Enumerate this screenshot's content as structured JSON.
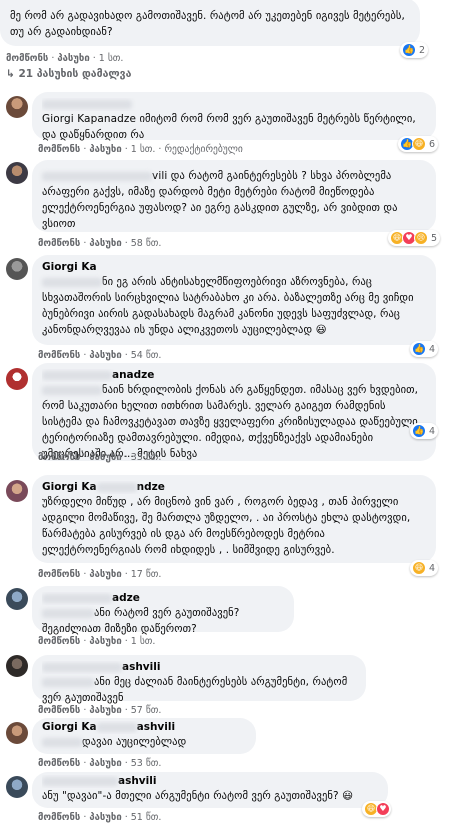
{
  "comments": [
    {
      "name": "",
      "text": "მე რომ არ გადავიხადო გამოთიშავენ. რატომ არ უკეთებენ იგივეს მეტერებს, თუ არ გადაიხდიან?",
      "actions": {
        "like": "მომწონს",
        "reply": "პასუხი",
        "time": "1 სთ."
      },
      "reactions": {
        "count": "2",
        "icons": [
          "like-icon"
        ]
      }
    },
    {
      "name": "",
      "text": "Giorgi Kapanadze იმიტომ რომ რომ ვერ გაუთიშავენ მეტრებს წერტილი, და დაწყნარდით რა",
      "actions": {
        "like": "მომწონს",
        "reply": "პასუხი",
        "time": "1 სთ.",
        "edited": "რედაქტირებული"
      },
      "reactions": {
        "count": "6",
        "icons": [
          "like-icon",
          "haha-icon"
        ]
      }
    },
    {
      "name": "",
      "text_suffix": "vili და რატომ გაინტერესებს ? სხვა პრობლემა არაფერი გაქვს, იმაზე დარდობ მეტი მეტრები რატომ მიეწოდება ელექტროენერგია უფასოდ? აი ეგრე გასკდით გულზე, არ ვიბდით და ვსიოთ",
      "actions": {
        "like": "მომწონს",
        "reply": "პასუხი",
        "time": "58 წთ."
      },
      "reactions": {
        "count": "5",
        "icons": [
          "haha-icon",
          "love-icon",
          "sad-icon"
        ]
      }
    },
    {
      "name": "Giorgi Ka",
      "text_suffix": "ნი ეგ არის ანტისახელმწიფოებრივი აზროვნება, რაც სხვათაშორის სირცხვილია სატრაბახო კი არა. ბაზალეთზე არც მე ვიჩდი ბუნებრივი აირის გადასახადს მაგრამ კანონი უდევს საფუძვლად, რაც კანონდარღვევაა ის უნდა ალიკვეთოს აუცილებლად",
      "emoji": "😃",
      "actions": {
        "like": "მომწონს",
        "reply": "პასუხი",
        "time": "54 წთ."
      },
      "reactions": {
        "count": "4",
        "icons": [
          "like-icon"
        ]
      }
    },
    {
      "name_suffix": "anadze",
      "text_suffix": "ნაინ ხრდილობის ქონას არ გაწყენდეთ. იმასაც ვერ ხვდებით, რომ საკუთარი ხელით ითხრით სამარეს. ველარ გაიგეთ რამდენის სისტემა და ჩამოვკეტავათ თავზე ყველაფერი კრიზისულადაა დაწეებული ტერიტორიაზე დამთავრებული. იმედია, თქვენზეაქვს ადამიანები უმეცრესიაში არ... მეტის ნახვა",
      "actions": {
        "like": "მომწონს",
        "reply": "პასუხი",
        "time": "33 წთ."
      },
      "reactions": {
        "count": "4",
        "icons": [
          "like-icon"
        ]
      }
    },
    {
      "name": "Giorgi Ka",
      "name_mid": "ndze",
      "text": "უზრდელი მიწუდ , არ მიცნობ ვინ ვარ , როგორ ბედავ , თან პირველი ადგილი მომაწივე, შე მართლა უზდელო, . აი პროსტა ეხლა დასტოვდი, წარმატება გისურვებ ის დგა არ მოესწრებოდეს მეტრია ელექტროენერგიას რომ იხდიდეს , . სიმშვიდე გისურვებ.",
      "actions": {
        "like": "მომწონს",
        "reply": "პასუხი",
        "time": "17 წთ."
      },
      "reactions": {
        "count": "4",
        "icons": [
          "haha-icon"
        ]
      }
    },
    {
      "name_suffix": "adze",
      "text_suffix": "ანი რატომ ვერ გაუთიშავენ? შეგიძლიათ მიზეზი დაწეროთ?",
      "actions": {
        "like": "მომწონს",
        "reply": "პასუხი",
        "time": "1 სთ."
      }
    },
    {
      "name_suffix": "ashvili",
      "text_suffix": "ანი მეც ძალიან მაინტერესებს არგუმენტი, რატომ ვერ გაუთიშავენ",
      "actions": {
        "like": "მომწონს",
        "reply": "პასუხი",
        "time": "57 წთ."
      }
    },
    {
      "name": "Giorgi Ka",
      "name_mid": "ashvili",
      "text": "დავაი აუცილებლად",
      "actions": {
        "like": "მომწონს",
        "reply": "პასუხი",
        "time": "53 წთ."
      }
    },
    {
      "name_suffix": "ashvili",
      "text": "ანუ \"დავაი\"-ა მთელი არგუმენტი რატომ ვერ გაუთიშავენ?",
      "emoji": "😃",
      "actions": {
        "like": "მომწონს",
        "reply": "პასუხი",
        "time": "51 წთ."
      },
      "reactions": {
        "count": "",
        "icons": [
          "haha-icon",
          "love-icon"
        ]
      }
    }
  ],
  "hidden_replies": "21 პასუხის დამალვა",
  "colors": {
    "bubble": "#f0f2f5",
    "like": "#1877f2",
    "meta": "#65676b"
  }
}
